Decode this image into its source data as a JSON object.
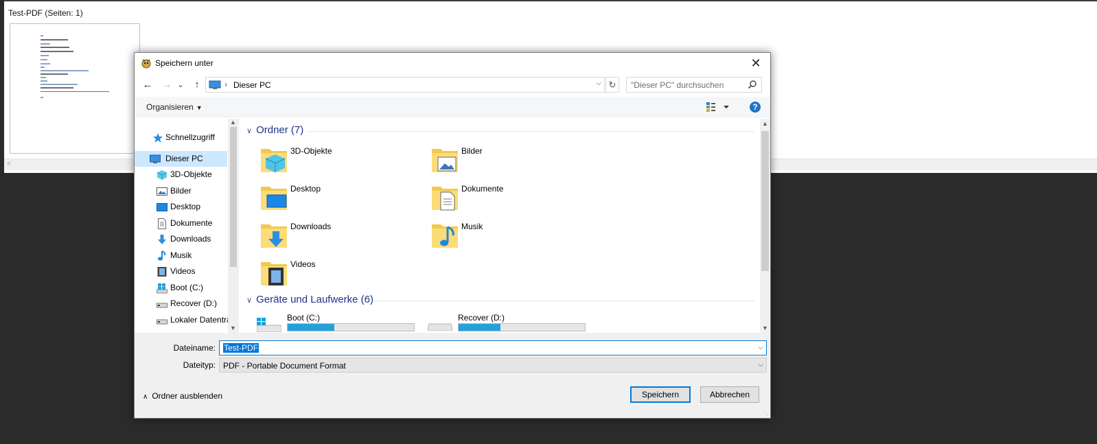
{
  "background_app": {
    "title": "Test-PDF (Seiten: 1)",
    "scroll_arrow": "<"
  },
  "dialog": {
    "title": "Speichern unter",
    "close": "✕",
    "nav": {
      "back": "←",
      "forward": "→",
      "recent": "⌄",
      "up": "↑",
      "breadcrumb_sep": "›",
      "address_path": "Dieser PC",
      "refresh": "↻",
      "search_placeholder": "\"Dieser PC\" durchsuchen"
    },
    "toolbar": {
      "organize": "Organisieren",
      "help": "?"
    },
    "sidebar": {
      "items": [
        {
          "label": "Schnellzugriff",
          "icon": "star-icon"
        },
        {
          "label": "Dieser PC",
          "icon": "pc-icon",
          "selected": true
        },
        {
          "label": "3D-Objekte",
          "icon": "cube-icon"
        },
        {
          "label": "Bilder",
          "icon": "pictures-icon"
        },
        {
          "label": "Desktop",
          "icon": "desktop-icon"
        },
        {
          "label": "Dokumente",
          "icon": "documents-icon"
        },
        {
          "label": "Downloads",
          "icon": "download-icon"
        },
        {
          "label": "Musik",
          "icon": "music-icon"
        },
        {
          "label": "Videos",
          "icon": "video-icon"
        },
        {
          "label": "Boot (C:)",
          "icon": "windows-drive-icon"
        },
        {
          "label": "Recover (D:)",
          "icon": "drive-icon"
        },
        {
          "label": "Lokaler Datenträ",
          "icon": "drive-icon"
        }
      ]
    },
    "content": {
      "folders_header": "Ordner (7)",
      "folders": [
        {
          "label": "3D-Objekte",
          "icon": "cube-folder-icon"
        },
        {
          "label": "Bilder",
          "icon": "pictures-folder-icon"
        },
        {
          "label": "Desktop",
          "icon": "desktop-folder-icon"
        },
        {
          "label": "Dokumente",
          "icon": "documents-folder-icon"
        },
        {
          "label": "Downloads",
          "icon": "downloads-folder-icon"
        },
        {
          "label": "Musik",
          "icon": "music-folder-icon"
        },
        {
          "label": "Videos",
          "icon": "videos-folder-icon"
        }
      ],
      "drives_header": "Geräte und Laufwerke (6)",
      "drives": [
        {
          "label": "Boot (C:)",
          "used_fraction": 0.37,
          "icon": "windows-drive-icon"
        },
        {
          "label": "Recover (D:)",
          "used_fraction": 0.33,
          "icon": "drive-icon"
        }
      ]
    },
    "fields": {
      "filename_label": "Dateiname:",
      "filename_value": "Test-PDF",
      "filetype_label": "Dateityp:",
      "filetype_value": "PDF - Portable Document Format"
    },
    "footer": {
      "hide_folders": "Ordner ausblenden",
      "save": "Speichern",
      "cancel": "Abbrechen"
    },
    "colors": {
      "accent": "#0078d7",
      "header_text": "#1e3287",
      "drive_fill": "#26a0da",
      "selection": "#cce8ff"
    }
  }
}
